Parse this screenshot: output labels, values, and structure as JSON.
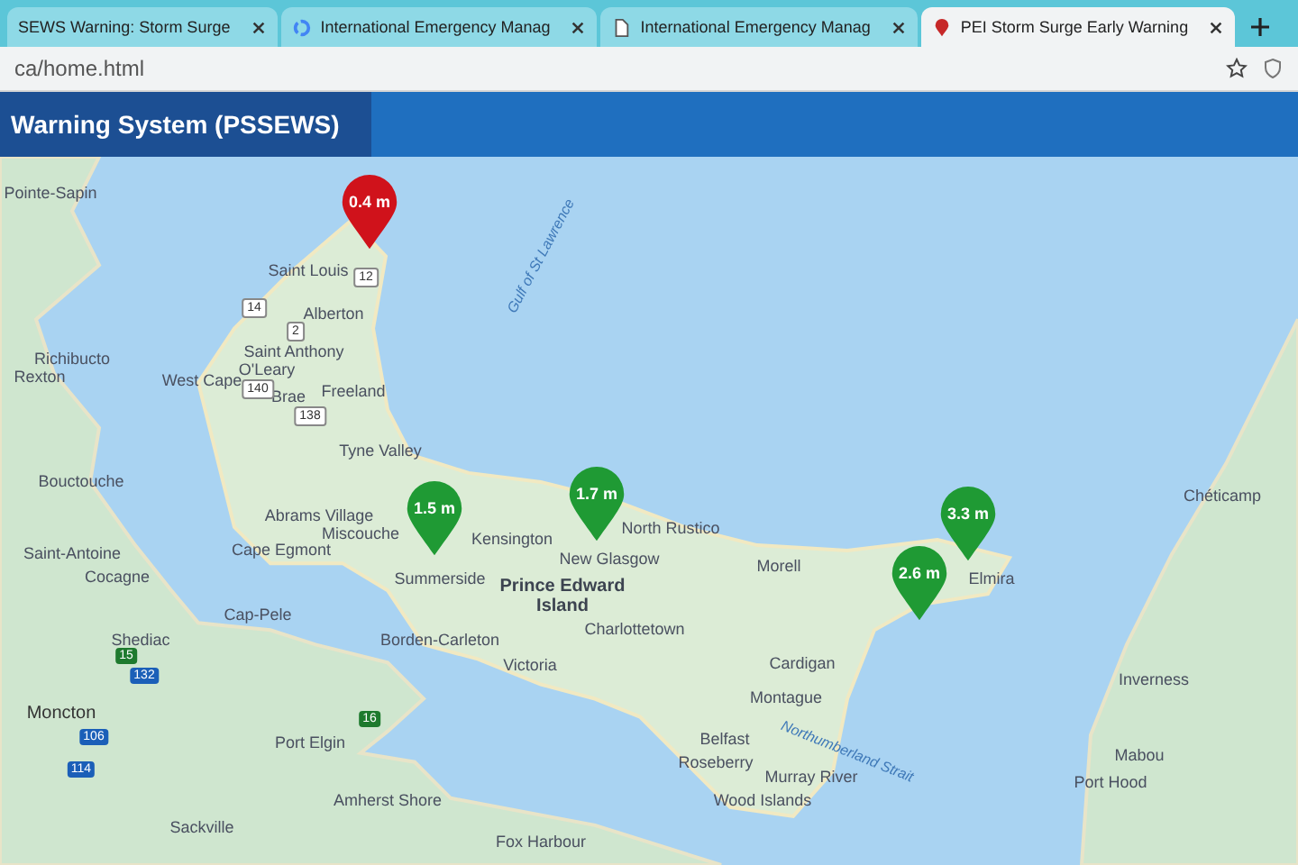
{
  "browser": {
    "tabs": [
      {
        "title": "SEWS Warning: Storm Surge",
        "selected": false
      },
      {
        "title": "International Emergency Manag",
        "selected": false
      },
      {
        "title": "International Emergency Manag",
        "selected": false
      },
      {
        "title": "PEI Storm Surge Early Warning",
        "selected": true
      }
    ],
    "url": "ca/home.html"
  },
  "app_header": {
    "title": "Warning System (PSSEWS)"
  },
  "map": {
    "places": [
      {
        "name": "Pointe-Sapin",
        "kind": "town"
      },
      {
        "name": "Saint Louis",
        "kind": "town"
      },
      {
        "name": "Alberton",
        "kind": "town"
      },
      {
        "name": "Saint Anthony",
        "kind": "town"
      },
      {
        "name": "Richibucto",
        "kind": "town"
      },
      {
        "name": "O'Leary",
        "kind": "town"
      },
      {
        "name": "Rexton",
        "kind": "town"
      },
      {
        "name": "West Cape",
        "kind": "town"
      },
      {
        "name": "Freeland",
        "kind": "town"
      },
      {
        "name": "Brae",
        "kind": "town"
      },
      {
        "name": "Tyne Valley",
        "kind": "town"
      },
      {
        "name": "Bouctouche",
        "kind": "town"
      },
      {
        "name": "Chéticamp",
        "kind": "town"
      },
      {
        "name": "Abrams Village",
        "kind": "town"
      },
      {
        "name": "North Rustico",
        "kind": "town"
      },
      {
        "name": "Miscouche",
        "kind": "town"
      },
      {
        "name": "Kensington",
        "kind": "town"
      },
      {
        "name": "Cape Egmont",
        "kind": "town"
      },
      {
        "name": "Saint-Antoine",
        "kind": "town"
      },
      {
        "name": "New Glasgow",
        "kind": "town"
      },
      {
        "name": "Morell",
        "kind": "town"
      },
      {
        "name": "Cocagne",
        "kind": "town"
      },
      {
        "name": "Summerside",
        "kind": "town"
      },
      {
        "name": "Elmira",
        "kind": "town"
      },
      {
        "name": "Cap-Pele",
        "kind": "town"
      },
      {
        "name": "Prince Edward Island",
        "kind": "region"
      },
      {
        "name": "Charlottetown",
        "kind": "town"
      },
      {
        "name": "Shediac",
        "kind": "town"
      },
      {
        "name": "Borden-Carleton",
        "kind": "town"
      },
      {
        "name": "Cardigan",
        "kind": "town"
      },
      {
        "name": "Victoria",
        "kind": "town"
      },
      {
        "name": "Inverness",
        "kind": "town"
      },
      {
        "name": "Montague",
        "kind": "town"
      },
      {
        "name": "Moncton",
        "kind": "city"
      },
      {
        "name": "Belfast",
        "kind": "town"
      },
      {
        "name": "Port Elgin",
        "kind": "town"
      },
      {
        "name": "Mabou",
        "kind": "town"
      },
      {
        "name": "Roseberry",
        "kind": "town"
      },
      {
        "name": "Murray River",
        "kind": "town"
      },
      {
        "name": "Port Hood",
        "kind": "town"
      },
      {
        "name": "Amherst Shore",
        "kind": "town"
      },
      {
        "name": "Wood Islands",
        "kind": "town"
      },
      {
        "name": "Sackville",
        "kind": "town"
      },
      {
        "name": "Fox Harbour",
        "kind": "town"
      }
    ],
    "water_labels": [
      "Gulf of St Lawrence",
      "Northumberland Strait"
    ],
    "shields": [
      {
        "number": "12",
        "kind": "provincial"
      },
      {
        "number": "14",
        "kind": "provincial"
      },
      {
        "number": "2",
        "kind": "provincial"
      },
      {
        "number": "140",
        "kind": "provincial"
      },
      {
        "number": "138",
        "kind": "provincial"
      },
      {
        "number": "15",
        "kind": "route"
      },
      {
        "number": "132",
        "kind": "highway"
      },
      {
        "number": "16",
        "kind": "route"
      },
      {
        "number": "106",
        "kind": "highway"
      },
      {
        "number": "114",
        "kind": "highway"
      }
    ],
    "markers": [
      {
        "label": "0.4 m",
        "color": "#d0121b"
      },
      {
        "label": "1.7 m",
        "color": "#1f9a34"
      },
      {
        "label": "1.5 m",
        "color": "#1f9a34"
      },
      {
        "label": "3.3 m",
        "color": "#1f9a34"
      },
      {
        "label": "2.6 m",
        "color": "#1f9a34"
      }
    ]
  }
}
